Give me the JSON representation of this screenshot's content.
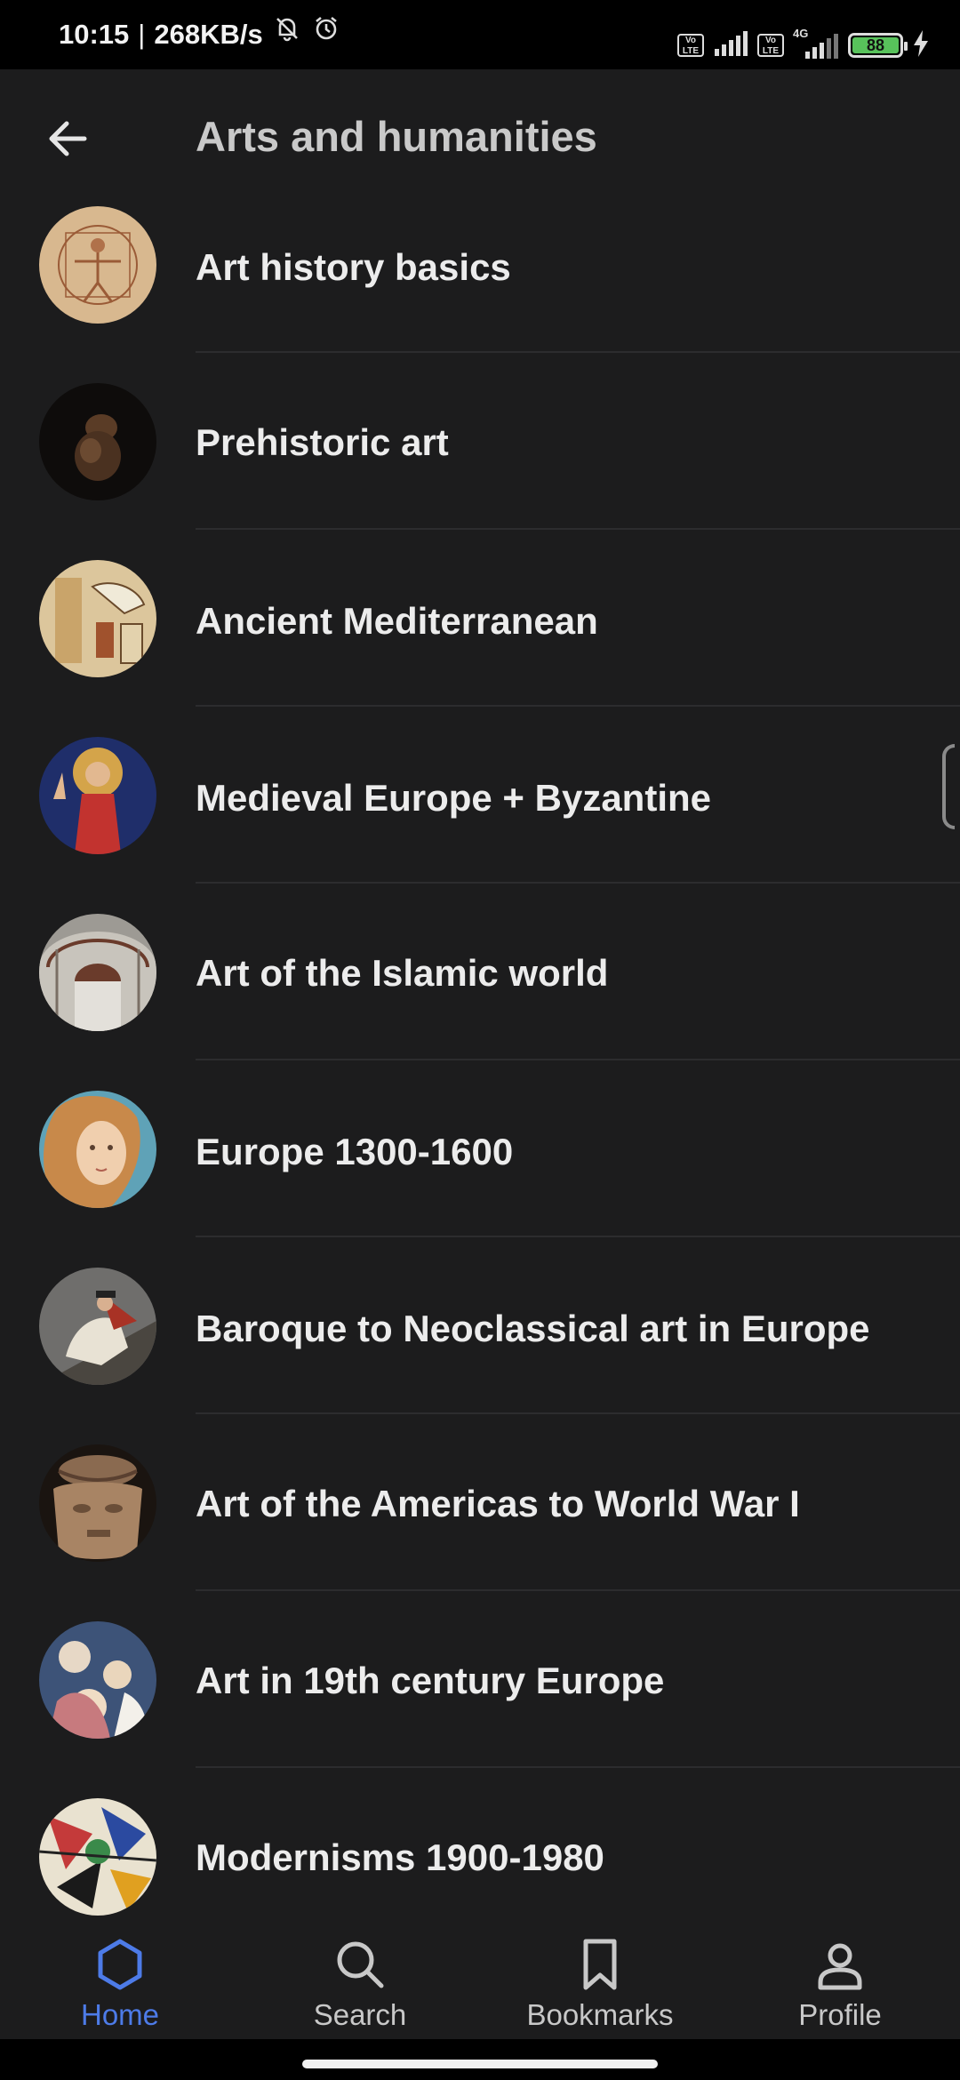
{
  "status_bar": {
    "time": "10:15",
    "separator": "|",
    "speed": "268KB/s",
    "battery_level": "88",
    "volte_label": "Vo LTE",
    "network_label": "4G"
  },
  "header": {
    "title": "Arts and humanities",
    "back_icon": "arrow-left-icon"
  },
  "list": {
    "items": [
      {
        "label": "Art history basics",
        "thumb": "vitruvian-sketch",
        "color": "#d6b48c"
      },
      {
        "label": "Prehistoric art",
        "thumb": "venus-figurine",
        "color": "#3b2a1c"
      },
      {
        "label": "Ancient Mediterranean",
        "thumb": "egyptian-papyrus",
        "color": "#d9c49a"
      },
      {
        "label": "Medieval Europe + Byzantine",
        "thumb": "byzantine-icon",
        "color": "#c2332f"
      },
      {
        "label": "Art of the Islamic world",
        "thumb": "mosque-dome",
        "color": "#b9b5ae"
      },
      {
        "label": "Europe 1300-1600",
        "thumb": "botticelli-venus",
        "color": "#c8894a"
      },
      {
        "label": "Baroque to Neoclassical art in Europe",
        "thumb": "napoleon-crossing-alps",
        "color": "#a54a3a"
      },
      {
        "label": "Art of the Americas to World War I",
        "thumb": "olmec-mask",
        "color": "#a88464"
      },
      {
        "label": "Art in 19th century Europe",
        "thumb": "renoir-painting",
        "color": "#4f6b8f"
      },
      {
        "label": "Modernisms 1900-1980",
        "thumb": "abstract-painting",
        "color": "#c43a3a"
      }
    ]
  },
  "bottom_nav": {
    "items": [
      {
        "label": "Home",
        "icon": "hexagon-icon",
        "active": true
      },
      {
        "label": "Search",
        "icon": "search-icon",
        "active": false
      },
      {
        "label": "Bookmarks",
        "icon": "bookmark-icon",
        "active": false
      },
      {
        "label": "Profile",
        "icon": "profile-icon",
        "active": false
      }
    ]
  },
  "colors": {
    "background": "#1c1c1d",
    "accent": "#4d7be8",
    "text": "#ececec",
    "title_text": "#c9c9c9"
  }
}
